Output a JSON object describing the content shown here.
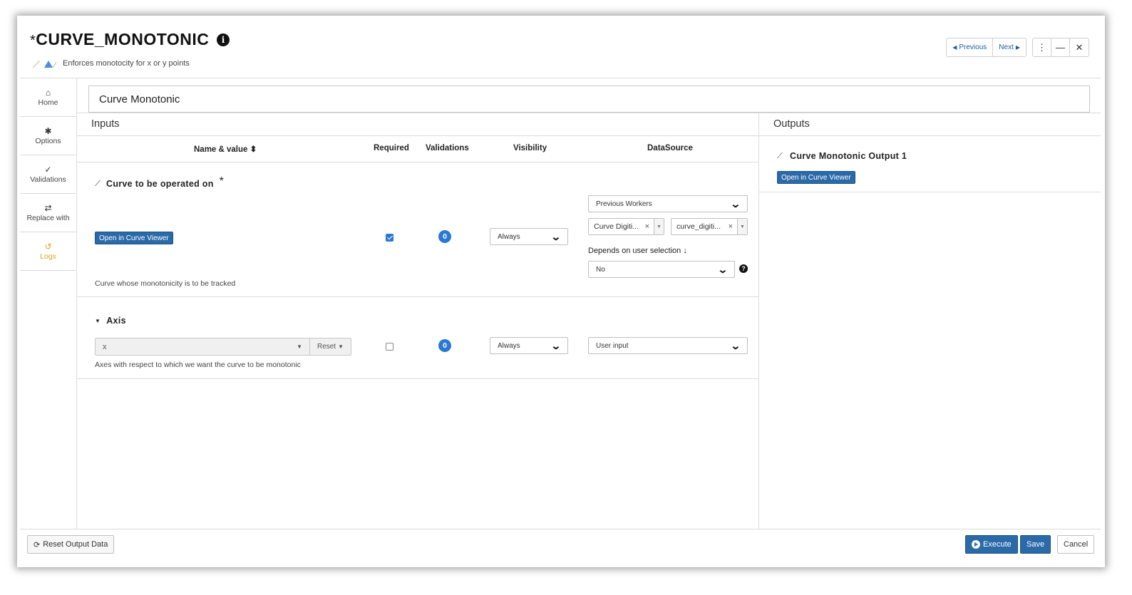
{
  "header": {
    "title_prefix": "*",
    "title": "CURVE_MONOTONIC",
    "subtitle": "Enforces monotocity for x or y points",
    "previous_label": "Previous",
    "next_label": "Next"
  },
  "sidebar": {
    "items": [
      {
        "label": "Home",
        "icon": "home-icon"
      },
      {
        "label": "Options",
        "icon": "gear-icon"
      },
      {
        "label": "Validations",
        "icon": "check-icon"
      },
      {
        "label": "Replace with",
        "icon": "swap-icon"
      },
      {
        "label": "Logs",
        "icon": "history-icon"
      }
    ]
  },
  "worker_name": "Curve Monotonic",
  "inputs": {
    "title": "Inputs",
    "columns": {
      "name": "Name & value",
      "required": "Required",
      "validations": "Validations",
      "visibility": "Visibility",
      "datasource": "DataSource"
    },
    "params": [
      {
        "title": "Curve to be operated on",
        "required_marker": "*",
        "button": "Open in Curve Viewer",
        "description": "Curve whose monotonicity is to be tracked",
        "required": true,
        "validations_count": "0",
        "visibility": "Always",
        "datasource": "Previous Workers",
        "tag1": "Curve Digiti...",
        "tag2": "curve_digiti...",
        "depends_label": "Depends on user selection",
        "depends_value": "No"
      },
      {
        "title": "Axis",
        "value": "x",
        "reset_label": "Reset",
        "description": "Axes with respect to which we want the curve to be monotonic",
        "required": false,
        "validations_count": "0",
        "visibility": "Always",
        "datasource": "User input"
      }
    ]
  },
  "outputs": {
    "title": "Outputs",
    "items": [
      {
        "title": "Curve Monotonic Output 1",
        "button": "Open in Curve Viewer"
      }
    ]
  },
  "footer": {
    "reset_output": "Reset Output Data",
    "execute": "Execute",
    "save": "Save",
    "cancel": "Cancel"
  },
  "colors": {
    "primary": "#2a6aa8",
    "badge": "#2a78d4",
    "logs": "#e0a020"
  }
}
